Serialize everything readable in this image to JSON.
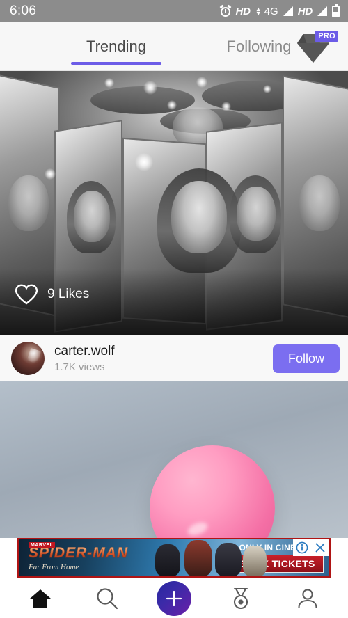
{
  "status_bar": {
    "time": "6:06",
    "alarm_icon": "alarm-clock-icon",
    "hd_label_1": "HD",
    "network_label": "4G",
    "hd_label_2": "HD",
    "signal_icon": "signal-bars-icon",
    "battery_icon": "battery-icon"
  },
  "tabs": {
    "items": [
      {
        "label": "Trending",
        "active": true
      },
      {
        "label": "Following",
        "active": false
      }
    ],
    "pro_badge": {
      "label": "PRO",
      "icon": "diamond-icon"
    },
    "active_underline_color": "#6c5ce7"
  },
  "feed": {
    "posts": [
      {
        "id": "post-1",
        "media_description": "Black and white mirror room with multiple reflections of a woman",
        "likes_text": "9 Likes",
        "like_icon": "heart-outline-icon",
        "user": {
          "name": "carter.wolf",
          "views": "1.7K views",
          "avatar": "user-avatar",
          "follow_label": "Follow",
          "follow_color": "#7b6ef0"
        }
      },
      {
        "id": "post-2",
        "media_description": "Pink balloon on a gray-blue gradient background"
      }
    ]
  },
  "ad": {
    "brand": "MARVEL",
    "title": "SPIDER-MAN",
    "subtitle": "Far From Home",
    "tagline": "ONLY IN CINEMAS",
    "cta_label": "BOOK TICKETS",
    "info_icon": "adchoices-info-icon",
    "close_icon": "close-icon",
    "border_color": "#b01414"
  },
  "bottom_nav": {
    "items": [
      {
        "name": "home",
        "icon": "home-icon",
        "active": true
      },
      {
        "name": "search",
        "icon": "search-icon",
        "active": false
      },
      {
        "name": "create",
        "icon": "plus-icon",
        "active": false
      },
      {
        "name": "awards",
        "icon": "medal-icon",
        "active": false
      },
      {
        "name": "profile",
        "icon": "person-icon",
        "active": false
      }
    ],
    "create_gradient": [
      "#2727a0",
      "#6a1fa8"
    ]
  }
}
